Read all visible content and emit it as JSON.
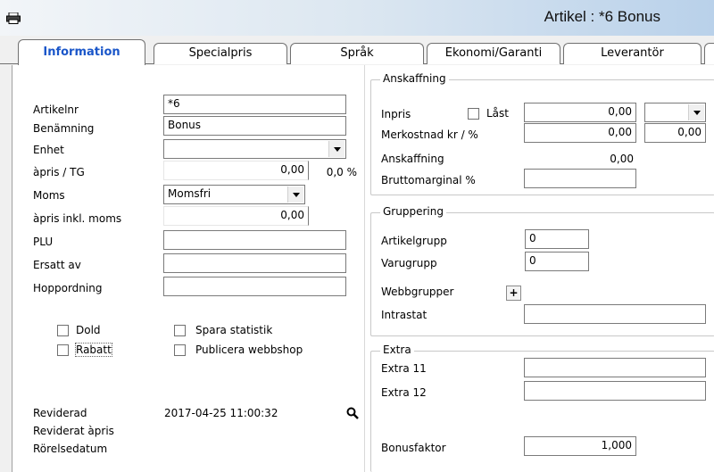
{
  "window": {
    "title": "Artikel : *6 Bonus",
    "icon": "printer-icon"
  },
  "tabs": [
    {
      "label": "Information",
      "active": true
    },
    {
      "label": "Specialpris"
    },
    {
      "label": "Språk"
    },
    {
      "label": "Ekonomi/Garanti"
    },
    {
      "label": "Leverantör"
    }
  ],
  "info": {
    "artikelnr_label": "Artikelnr",
    "artikelnr_value": "*6",
    "benamning_label": "Benämning",
    "benamning_value": "Bonus",
    "enhet_label": "Enhet",
    "enhet_value": "",
    "apris_tg_label": "àpris / TG",
    "apris_value": "0,00",
    "tg_value": "0,0 %",
    "moms_label": "Moms",
    "moms_value": "Momsfri",
    "apris_inkl_label": "àpris inkl. moms",
    "apris_inkl_value": "0,00",
    "plu_label": "PLU",
    "plu_value": "",
    "ersatt_label": "Ersatt av",
    "ersatt_value": "",
    "hoppordning_label": "Hoppordning",
    "hoppordning_value": ""
  },
  "checkboxes": {
    "dold": "Dold",
    "rabatt": "Rabatt",
    "spara_statistik": "Spara statistik",
    "publicera": "Publicera webbshop"
  },
  "revision": {
    "reviderad_label": "Reviderad",
    "reviderad_value": "2017-04-25 11:00:32",
    "reviderat_apris_label": "Reviderat àpris",
    "rorelsedatum_label": "Rörelsedatum"
  },
  "anskaffning": {
    "title": "Anskaffning",
    "inpris_label": "Inpris",
    "last_label": "Låst",
    "inpris_value": "0,00",
    "currency_value": "",
    "merkostnad_label": "Merkostnad kr / %",
    "merkostnad_kr": "0,00",
    "merkostnad_pct": "0,00",
    "anskaffning_label": "Anskaffning",
    "anskaffning_value": "0,00",
    "bruttomarginal_label": "Bruttomarginal %",
    "bruttomarginal_value": ""
  },
  "gruppering": {
    "title": "Gruppering",
    "artikelgrupp_label": "Artikelgrupp",
    "artikelgrupp_value": "0",
    "varugrupp_label": "Varugrupp",
    "varugrupp_value": "0",
    "webbgrupper_label": "Webbgrupper",
    "webbgrupper_btn": "+",
    "intrastat_label": "Intrastat",
    "intrastat_value": ""
  },
  "extra": {
    "title": "Extra",
    "extra11_label": "Extra 11",
    "extra11_value": "",
    "extra12_label": "Extra 12",
    "extra12_value": "",
    "bonusfaktor_label": "Bonusfaktor",
    "bonusfaktor_value": "1,000"
  }
}
